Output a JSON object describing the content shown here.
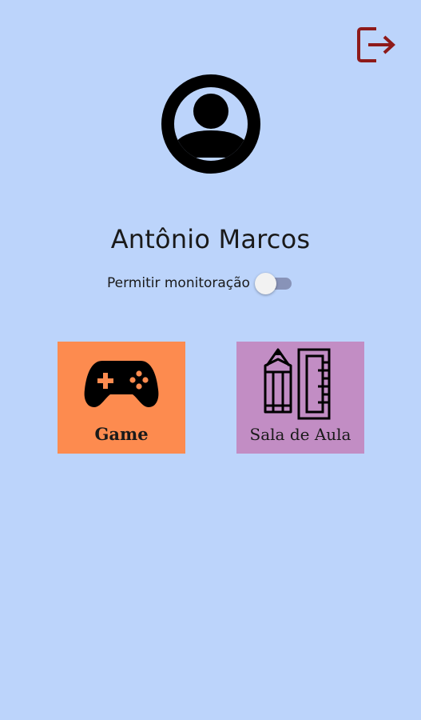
{
  "header": {
    "logout_icon": "logout-icon"
  },
  "profile": {
    "avatar_icon": "account-circle-icon",
    "name": "Antônio Marcos"
  },
  "monitoring": {
    "label": "Permitir monitoração",
    "enabled": false
  },
  "tiles": [
    {
      "label": "Game",
      "icon": "gamepad-icon",
      "color": "#fd8b4f"
    },
    {
      "label": "Sala de Aula",
      "icon": "pencil-ruler-icon",
      "color": "#c28dc4"
    }
  ],
  "colors": {
    "background": "#bcd4fb",
    "logout_accent": "#8e1a1a"
  }
}
